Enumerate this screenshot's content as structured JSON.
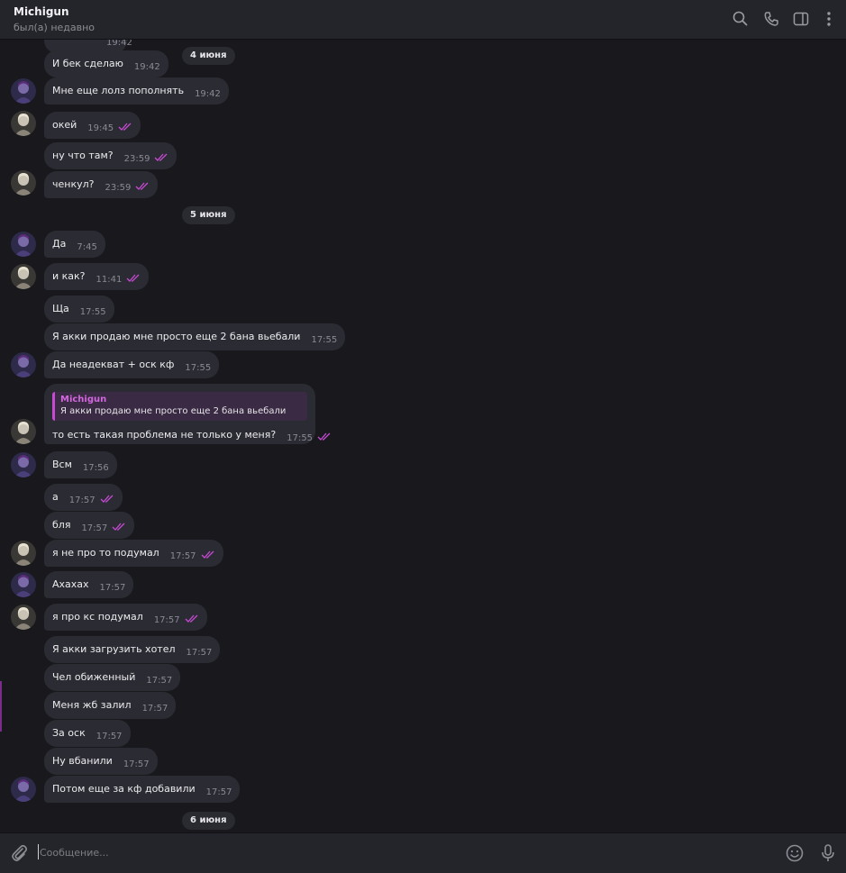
{
  "header": {
    "title": "Michigun",
    "status": "был(а) недавно",
    "icons": [
      "search-icon",
      "phone-icon",
      "sidebar-toggle-icon",
      "more-vertical-icon"
    ]
  },
  "dates": [
    "4 июня",
    "5 июня",
    "6 июня"
  ],
  "messages": [
    {
      "from": "peer",
      "text": "",
      "time": "19:42"
    },
    {
      "from": "peer",
      "text": "И бек сделаю",
      "time": "19:42"
    },
    {
      "from": "peer",
      "text": "Мне еще лолз пополнять",
      "time": "19:42"
    },
    {
      "from": "me",
      "text": "окей",
      "time": "19:45"
    },
    {
      "from": "me",
      "text": "ну что там?",
      "time": "23:59"
    },
    {
      "from": "me",
      "text": "ченкул?",
      "time": "23:59"
    },
    {
      "from": "peer",
      "text": "Да",
      "time": "7:45"
    },
    {
      "from": "me",
      "text": "и как?",
      "time": "11:41"
    },
    {
      "from": "peer",
      "text": "Ща",
      "time": "17:55"
    },
    {
      "from": "peer",
      "text": "Я акки продаю мне просто еще 2 бана вьебали",
      "time": "17:55"
    },
    {
      "from": "peer",
      "text": "Да неадекват + оск кф",
      "time": "17:55"
    },
    {
      "from": "me",
      "text": "то есть такая проблема не только у меня?",
      "time": "17:55"
    },
    {
      "from": "peer",
      "text": "Всм",
      "time": "17:56"
    },
    {
      "from": "me",
      "text": "а",
      "time": "17:57"
    },
    {
      "from": "me",
      "text": "бля",
      "time": "17:57"
    },
    {
      "from": "me",
      "text": "я не про то подумал",
      "time": "17:57"
    },
    {
      "from": "peer",
      "text": "Ахахах",
      "time": "17:57"
    },
    {
      "from": "me",
      "text": "я про кс подумал",
      "time": "17:57"
    },
    {
      "from": "peer",
      "text": "Я акки загрузить хотел",
      "time": "17:57"
    },
    {
      "from": "peer",
      "text": "Чел обиженный",
      "time": "17:57"
    },
    {
      "from": "peer",
      "text": "Меня жб залил",
      "time": "17:57"
    },
    {
      "from": "peer",
      "text": "За оск",
      "time": "17:57"
    },
    {
      "from": "peer",
      "text": "Ну вбанили",
      "time": "17:57"
    },
    {
      "from": "peer",
      "text": "Потом еще за кф добавили",
      "time": "17:57"
    }
  ],
  "reply": {
    "author": "Michigun",
    "quoted_text": "Я акки продаю мне просто еще 2 бана вьебали"
  },
  "composer": {
    "placeholder": "Сообщение...",
    "icons": [
      "paperclip-icon",
      "emoji-icon",
      "microphone-icon"
    ]
  },
  "colors": {
    "background": "#18181d",
    "header": "#24242b",
    "bubble": "#2b2b33",
    "accent": "#c64ad3",
    "read_ticks": "#c64ad3"
  }
}
